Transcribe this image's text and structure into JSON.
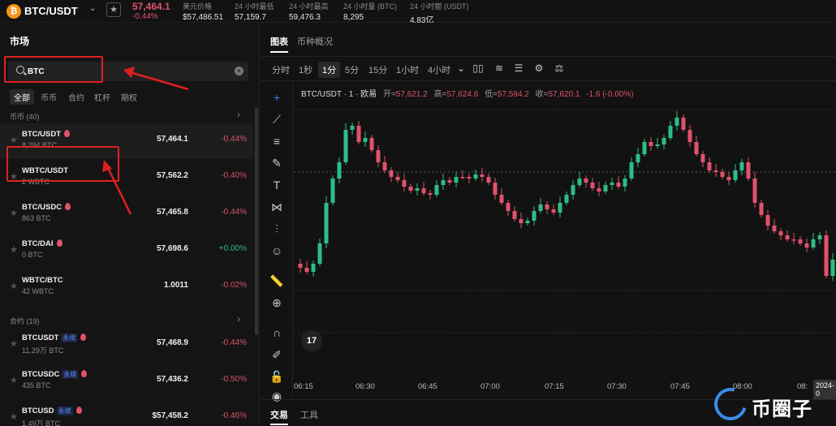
{
  "header": {
    "coin_logo": "₿",
    "pair": "BTC/USDT",
    "price": "57,464.1",
    "change": "-0.44%",
    "stats": [
      {
        "label": "美元价格",
        "value": "$57,486.51"
      },
      {
        "label": "24 小时最低",
        "value": "57,159.7"
      },
      {
        "label": "24 小时最高",
        "value": "59,476.3"
      },
      {
        "label": "24 小时量 (BTC)",
        "value": "8,295"
      },
      {
        "label": "24 小时额 (USDT)",
        "value": "4.83亿"
      }
    ]
  },
  "market": {
    "title": "市场",
    "search_value": "BTC",
    "categories": [
      "全部",
      "币币",
      "合约",
      "杠杆",
      "期权"
    ],
    "spot_section": "币币 (40)",
    "futures_section": "合约 (19)",
    "spot_rows": [
      {
        "symbol": "BTC/USDT",
        "sub": "8,294 BTC",
        "price": "57,464.1",
        "change": "-0.44%",
        "hot": true
      },
      {
        "symbol": "WBTC/USDT",
        "sub": "2 WBTC",
        "price": "57,562.2",
        "change": "-0.40%",
        "hot": false
      },
      {
        "symbol": "BTC/USDC",
        "sub": "863 BTC",
        "price": "57,465.8",
        "change": "-0.44%",
        "hot": true
      },
      {
        "symbol": "BTC/DAI",
        "sub": "0 BTC",
        "price": "57,698.6",
        "change": "+0.00%",
        "hot": true
      },
      {
        "symbol": "WBTC/BTC",
        "sub": "42 WBTC",
        "price": "1.0011",
        "change": "-0.02%",
        "hot": false
      }
    ],
    "futures_rows": [
      {
        "symbol": "BTCUSDT",
        "tag": "永续",
        "sub": "11.29万 BTC",
        "price": "57,468.9",
        "change": "-0.44%"
      },
      {
        "symbol": "BTCUSDC",
        "tag": "永续",
        "sub": "435 BTC",
        "price": "57,436.2",
        "change": "-0.50%"
      },
      {
        "symbol": "BTCUSD",
        "tag": "永续",
        "sub": "1.49万 BTC",
        "price": "$57,458.2",
        "change": "-0.46%"
      }
    ]
  },
  "chart_panel": {
    "tabs": [
      "图表",
      "币种概况"
    ],
    "timeframes": [
      "分时",
      "1秒",
      "1分",
      "5分",
      "15分",
      "1小时",
      "4小时"
    ],
    "legend": {
      "title": "BTC/USDT · 1 · 欧易",
      "open_label": "开=",
      "open": "57,621.2",
      "high_label": "高=",
      "high": "57,624.6",
      "low_label": "低=",
      "low": "57,594.2",
      "close_label": "收=",
      "close": "57,620.1",
      "change": "-1.6 (-0.00%)"
    },
    "x_labels": [
      "06:15",
      "06:30",
      "06:45",
      "07:00",
      "07:15",
      "07:30",
      "07:45",
      "08:00",
      "08:"
    ],
    "x_label_box": "2024-0",
    "tv_logo": "17",
    "bottom_tabs": [
      "交易",
      "工具"
    ]
  },
  "chart_data": {
    "type": "candlestick",
    "interval": "1m",
    "x_ticks": [
      "06:15",
      "06:30",
      "06:45",
      "07:00",
      "07:15",
      "07:30",
      "07:45",
      "08:00"
    ]
  },
  "watermark": {
    "text": "币圈子"
  },
  "colors": {
    "up": "#2ebd85",
    "down": "#e0526b",
    "accent": "#3b82f6"
  }
}
